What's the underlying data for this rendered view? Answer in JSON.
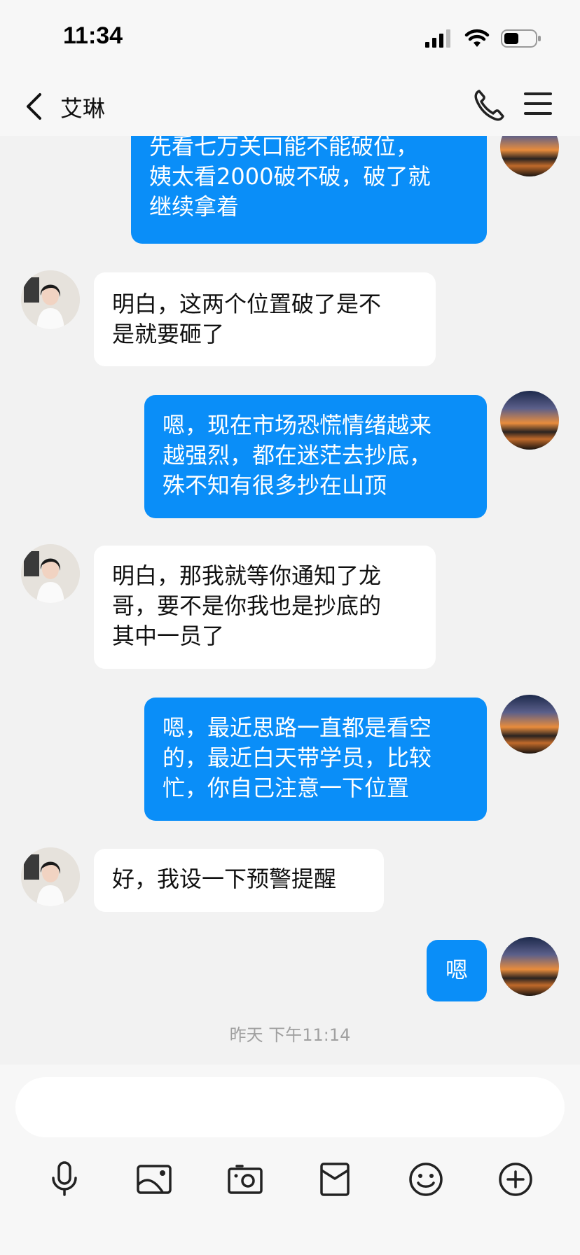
{
  "status_bar": {
    "time": "11:34"
  },
  "header": {
    "title": "艾琳"
  },
  "messages": [
    {
      "side": "out",
      "lines": [
        "先看七万关口能不能破位，",
        "姨太看2000破不破，破了就",
        "继续拿着"
      ]
    },
    {
      "side": "in",
      "lines": [
        "明白，这两个位置破了是不",
        "是就要砸了"
      ]
    },
    {
      "side": "out",
      "lines": [
        "嗯，现在市场恐慌情绪越来",
        "越强烈，都在迷茫去抄底，",
        "殊不知有很多抄在山顶"
      ]
    },
    {
      "side": "in",
      "lines": [
        "明白，那我就等你通知了龙",
        "哥，要不是你我也是抄底的",
        "其中一员了"
      ]
    },
    {
      "side": "out",
      "lines": [
        "嗯，最近思路一直都是看空",
        "的，最近白天带学员，比较",
        "忙，你自己注意一下位置"
      ]
    },
    {
      "side": "in",
      "lines": [
        "好，我设一下预警提醒"
      ]
    },
    {
      "side": "out",
      "lines": [
        "嗯"
      ]
    }
  ],
  "timestamp": "昨天 下午11:14",
  "input": {
    "value": "",
    "placeholder": ""
  },
  "toolbar": {
    "icons": [
      "microphone-icon",
      "image-icon",
      "camera-icon",
      "red-packet-icon",
      "emoji-icon",
      "plus-icon"
    ]
  },
  "colors": {
    "bubble_out": "#0a8ef8",
    "bubble_in": "#ffffff",
    "background": "#f2f2f2"
  }
}
